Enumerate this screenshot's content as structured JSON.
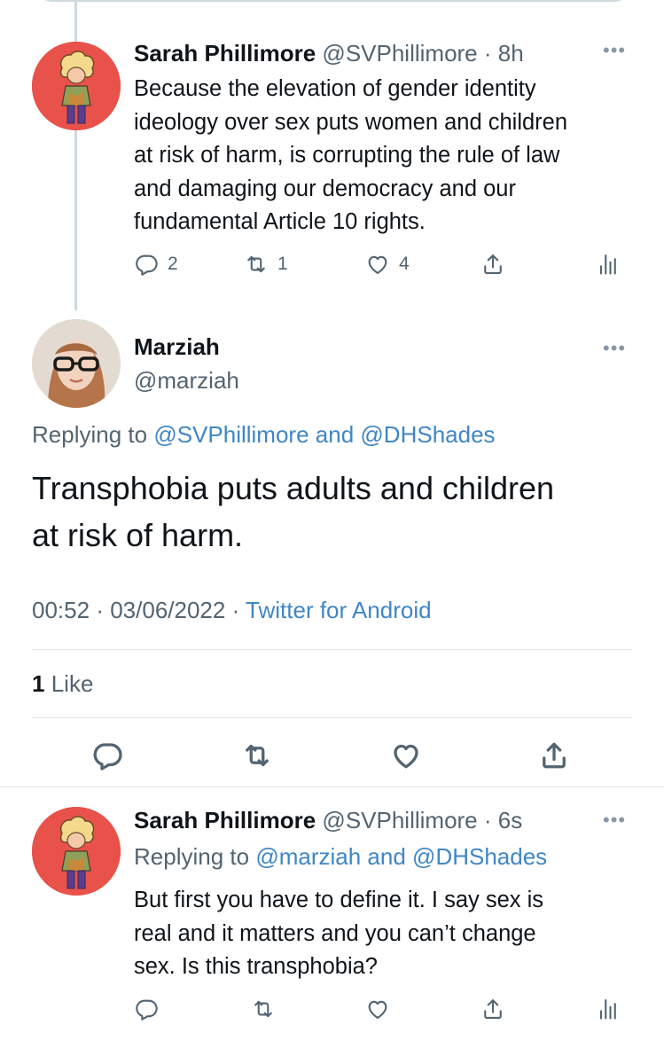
{
  "tweet1": {
    "name": "Sarah Phillimore",
    "handle": "@SVPhillimore",
    "sep": "·",
    "time": "8h",
    "text_lines": [
      "Because the elevation of gender identity",
      "ideology over sex puts women and children",
      "at risk of harm, is corrupting the rule of law",
      "and damaging our democracy and our",
      "fundamental Article 10 rights."
    ],
    "replies": "2",
    "retweets": "1",
    "likes": "4"
  },
  "main_tweet": {
    "name": "Marziah",
    "handle": "@marziah",
    "replying_prefix": "Replying to",
    "replying_user1": "@SVPhillimore",
    "replying_and": "and",
    "replying_user2": "@DHShades",
    "text_lines": [
      "Transphobia puts adults and children",
      "at risk of harm."
    ],
    "time": "00:52",
    "sep1": "·",
    "date": "03/06/2022",
    "sep2": "·",
    "source": "Twitter for Android",
    "likes_count": "1",
    "likes_label": "Like"
  },
  "tweet3": {
    "name": "Sarah Phillimore",
    "handle": "@SVPhillimore",
    "sep": "·",
    "time": "6s",
    "replying_prefix": "Replying to",
    "replying_user1": "@marziah",
    "replying_and": "and",
    "replying_user2": "@DHShades",
    "text_lines": [
      "But first you have to define it. I say sex is",
      "real and it matters and you can’t change",
      "sex. Is this transphobia?"
    ]
  },
  "icons": {
    "more": "more-icon",
    "reply": "reply-icon",
    "retweet": "retweet-icon",
    "like": "heart-icon",
    "share": "share-icon",
    "analytics": "analytics-icon"
  },
  "colors": {
    "link": "#1d9bf0",
    "muted": "#536471",
    "text": "#0f1419"
  }
}
